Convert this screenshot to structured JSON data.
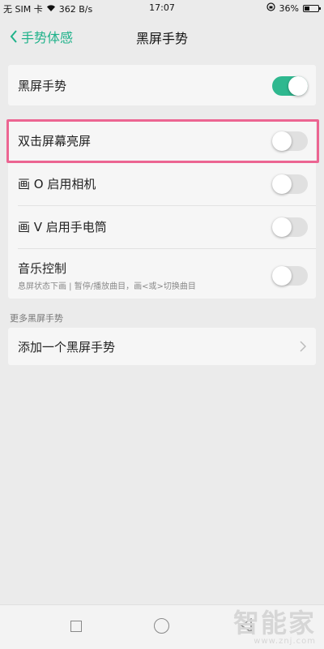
{
  "status_bar": {
    "carrier": "无 SIM 卡",
    "speed": "362 B/s",
    "time": "17:07",
    "battery": "36%"
  },
  "nav": {
    "back_label": "手势体感",
    "title": "黑屏手势"
  },
  "main_toggle": {
    "label": "黑屏手势",
    "enabled": true
  },
  "gestures": [
    {
      "label": "双击屏幕亮屏",
      "enabled": false,
      "highlighted": true
    },
    {
      "label": "画 O 启用相机",
      "enabled": false
    },
    {
      "label": "画 V 启用手电筒",
      "enabled": false
    },
    {
      "label": "音乐控制",
      "sublabel": "息屏状态下画 | 暂停/播放曲目，画<或>切换曲目",
      "enabled": false
    }
  ],
  "more_section": {
    "header": "更多黑屏手势",
    "add_label": "添加一个黑屏手势"
  },
  "colors": {
    "accent": "#1fb28a",
    "toggle_on": "#2fb88f",
    "highlight": "#ec6592"
  },
  "watermark": {
    "logo": "智能家",
    "url": "www.znj.com"
  }
}
